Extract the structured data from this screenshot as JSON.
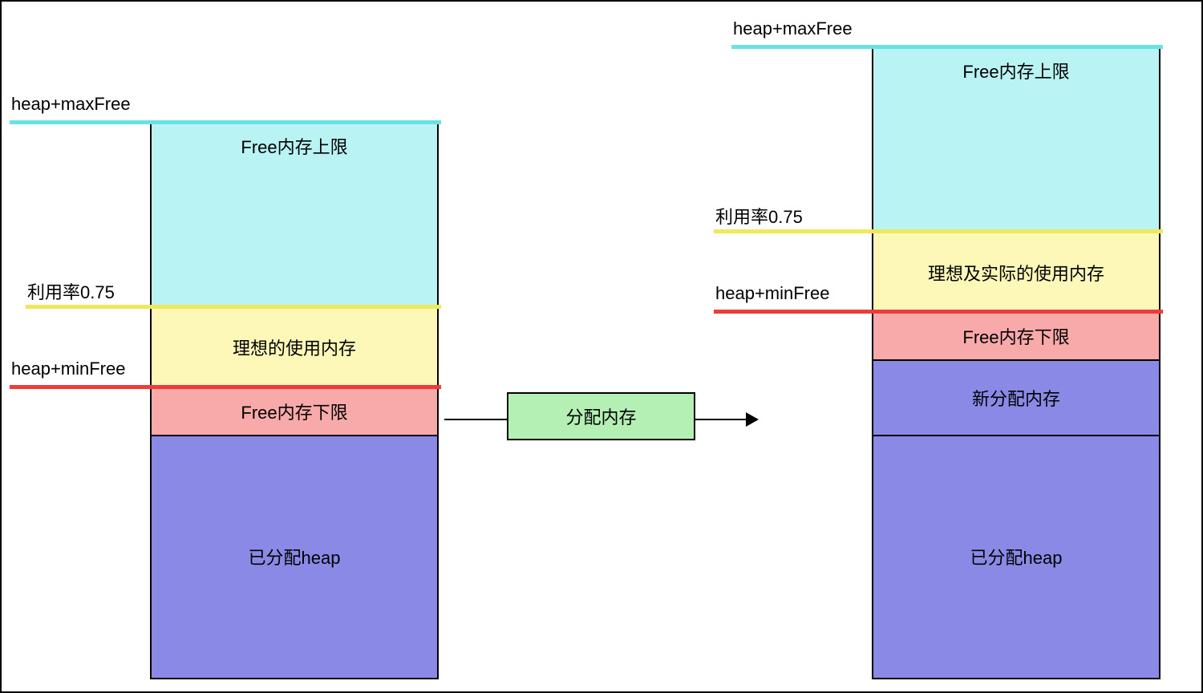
{
  "colors": {
    "cyan": "#B9F3F3",
    "cyanLine": "#67E3E3",
    "yellow": "#FDF8B8",
    "yellowLine": "#F0E85A",
    "red": "#F8A9A9",
    "redLine": "#F03B3B",
    "purple": "#8A8AE6",
    "green": "#B4EFB4"
  },
  "left": {
    "labels": {
      "heapMaxFree": "heap+maxFree",
      "utilization": "利用率0.75",
      "heapMinFree": "heap+minFree"
    },
    "segments": {
      "freeUpper": "Free内存上限",
      "ideal": "理想的使用内存",
      "freeLower": "Free内存下限",
      "allocated": "已分配heap"
    }
  },
  "center": {
    "action": "分配内存"
  },
  "right": {
    "labels": {
      "heapMaxFree": "heap+maxFree",
      "utilization": "利用率0.75",
      "heapMinFree": "heap+minFree"
    },
    "segments": {
      "freeUpper": "Free内存上限",
      "idealActual": "理想及实际的使用内存",
      "freeLower": "Free内存下限",
      "newAlloc": "新分配内存",
      "allocated": "已分配heap"
    }
  }
}
